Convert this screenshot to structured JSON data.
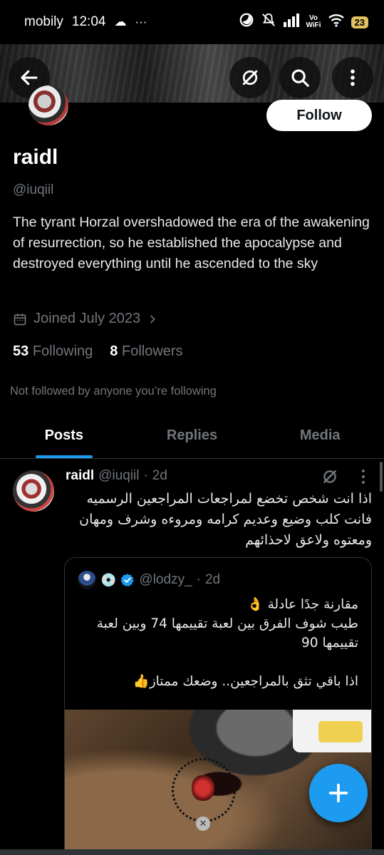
{
  "status_bar": {
    "carrier": "mobily",
    "time": "12:04",
    "weather_icon": "cloud-icon",
    "overflow_dots": "···",
    "icons": [
      "do-not-disturb-icon",
      "mute-icon",
      "signal-icon",
      "vowifi-icon",
      "wifi-icon"
    ],
    "vowifi_top": "Vo",
    "vowifi_bottom": "WiFi",
    "battery": "23"
  },
  "nav": {
    "back_icon": "arrow-left-icon",
    "grok_icon": "grok-icon",
    "search_icon": "search-icon",
    "more_icon": "more-vertical-icon"
  },
  "profile": {
    "follow_label": "Follow",
    "display_name": "raidl",
    "handle": "@iuqiil",
    "bio": "The tyrant Horzal overshadowed the era of the awakening of resurrection, so he established the apocalypse and destroyed everything until he ascended to the sky",
    "joined": "Joined July 2023",
    "following_count": "53",
    "following_label": "Following",
    "followers_count": "8",
    "followers_label": "Followers",
    "not_followed": "Not followed by anyone you’re following"
  },
  "tabs": [
    {
      "label": "Posts",
      "active": true
    },
    {
      "label": "Replies",
      "active": false
    },
    {
      "label": "Media",
      "active": false
    }
  ],
  "post": {
    "name": "raidl",
    "handle": "@iuqiil",
    "dot": "·",
    "time": "2d",
    "text": "اذا انت شخص تخضع لمراجعات المراجعين الرسميه فانت كلب وضيع وعديم كرامه ومروءه وشرف ومهان ومعتوه ولاعق لاحذائهم",
    "quote": {
      "disc_emoji": "💿",
      "handle": "@lodzy_",
      "dot": "·",
      "time": "2d",
      "text": "مقارنة جدًا عادلة 👌\nطيب شوف الفرق بين لعبة تقييمها 74 وبين لعبة تقييمها 90\n\nاذا باقي تثق بالمراجعين.. وضعك ممتاز👍"
    }
  },
  "fab": {
    "icon": "plus-icon"
  },
  "colors": {
    "accent": "#1d9bf0",
    "background": "#000000",
    "muted": "#71767b"
  }
}
